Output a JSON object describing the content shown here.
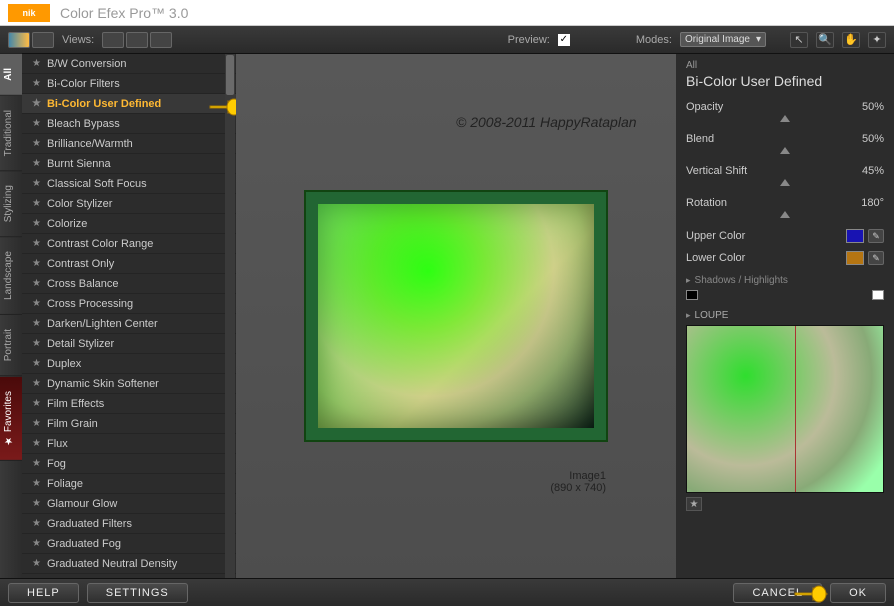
{
  "app": {
    "title": "Color Efex Pro™ 3.0",
    "logo": "nik"
  },
  "toolbar": {
    "views_label": "Views:",
    "preview_label": "Preview:",
    "preview_checked": "✓",
    "modes_label": "Modes:",
    "modes_value": "Original Image",
    "tool_icons": [
      "arrow",
      "zoom",
      "pan",
      "light"
    ]
  },
  "vtabs": {
    "items": [
      {
        "label": "All",
        "active": true
      },
      {
        "label": "Traditional",
        "active": false
      },
      {
        "label": "Stylizing",
        "active": false
      },
      {
        "label": "Landscape",
        "active": false
      },
      {
        "label": "Portrait",
        "active": false
      },
      {
        "label": "Favorites",
        "fav": true
      }
    ]
  },
  "filters": {
    "items": [
      "B/W Conversion",
      "Bi-Color Filters",
      "Bi-Color User Defined",
      "Bleach Bypass",
      "Brilliance/Warmth",
      "Burnt Sienna",
      "Classical Soft Focus",
      "Color Stylizer",
      "Colorize",
      "Contrast Color Range",
      "Contrast Only",
      "Cross Balance",
      "Cross Processing",
      "Darken/Lighten Center",
      "Detail Stylizer",
      "Duplex",
      "Dynamic Skin Softener",
      "Film Effects",
      "Film Grain",
      "Flux",
      "Fog",
      "Foliage",
      "Glamour Glow",
      "Graduated Filters",
      "Graduated Fog",
      "Graduated Neutral Density"
    ],
    "selected_index": 2
  },
  "preview": {
    "image_name": "Image1",
    "image_dims": "(890 x 740)",
    "watermark1": "© 2008-2011",
    "watermark2": "HappyRataplan"
  },
  "controls": {
    "category": "All",
    "filter_name": "Bi-Color User Defined",
    "sliders": [
      {
        "label": "Opacity",
        "value": "50%"
      },
      {
        "label": "Blend",
        "value": "50%"
      },
      {
        "label": "Vertical Shift",
        "value": "45%"
      },
      {
        "label": "Rotation",
        "value": "180°"
      }
    ],
    "upper_label": "Upper Color",
    "upper_value": "#1813b2",
    "lower_label": "Lower Color",
    "lower_value": "#b57512",
    "sh_label": "Shadows / Highlights",
    "loupe_label": "LOUPE"
  },
  "footer": {
    "help": "HELP",
    "settings": "SETTINGS",
    "cancel": "CANCEL",
    "ok": "OK"
  }
}
